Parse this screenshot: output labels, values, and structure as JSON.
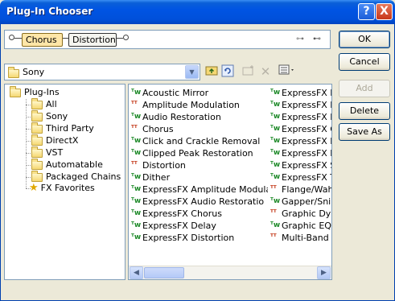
{
  "window": {
    "title": "Plug-In Chooser",
    "help_glyph": "?",
    "close_glyph": "X"
  },
  "chain": {
    "plugins": [
      "Chorus",
      "Distortion"
    ],
    "selected": "Chorus"
  },
  "buttons": {
    "ok": "OK",
    "cancel": "Cancel",
    "add": "Add",
    "delete": "Delete",
    "save_as": "Save As"
  },
  "folder_combo": {
    "value": "Sony"
  },
  "toolbar_icons": [
    "up-folder-icon",
    "refresh-icon",
    "new-folder-icon",
    "delete-icon",
    "view-menu-icon"
  ],
  "tree": {
    "root": "Plug-Ins",
    "children": [
      "All",
      "Sony",
      "Third Party",
      "DirectX",
      "VST",
      "Automatable",
      "Packaged Chains"
    ],
    "favorites": "FX Favorites"
  },
  "plugins": {
    "col1": [
      "Acoustic Mirror",
      "Amplitude Modulation",
      "Audio Restoration",
      "Chorus",
      "Click and Crackle Removal",
      "Clipped Peak Restoration",
      "Distortion",
      "Dither",
      "ExpressFX Amplitude Modulation",
      "ExpressFX Audio Restoration",
      "ExpressFX Chorus",
      "ExpressFX Delay",
      "ExpressFX Distortion"
    ],
    "col2": [
      "ExpressFX D",
      "ExpressFX Ec",
      "ExpressFX Fl",
      "ExpressFX Gr",
      "ExpressFX No",
      "ExpressFX Re",
      "ExpressFX St",
      "ExpressFX Ti",
      "Flange/Wah-",
      "Gapper/Snipp",
      "Graphic Dyna",
      "Graphic EQ",
      "Multi-Band D"
    ]
  },
  "colors": {
    "titlebar": "#0054e3",
    "dialog_bg": "#ece9d8",
    "selected_chip": "#ffe6a8"
  }
}
